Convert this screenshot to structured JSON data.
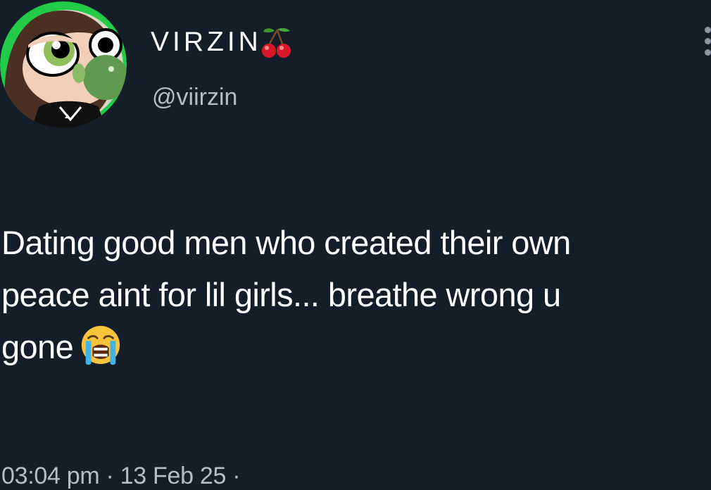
{
  "profile": {
    "display_name": "VIRZIN",
    "name_emoji": "cherries-icon",
    "handle": "@viirzin",
    "avatar": "powerpuff-girl-avatar-icon"
  },
  "tweet": {
    "lines": [
      "Dating good men who created their own",
      "peace aint for lil girls... breathe wrong u",
      "gone"
    ],
    "emoji": "loudly-crying-face-icon",
    "timestamp": "03:04 pm · 13 Feb 25 ·"
  },
  "menu": {
    "icon": "more-options-icon"
  },
  "colors": {
    "background": "#151d28",
    "text": "#ffffff",
    "secondary_text": "#b5bdc7",
    "avatar_ring": "#2fd45a"
  }
}
